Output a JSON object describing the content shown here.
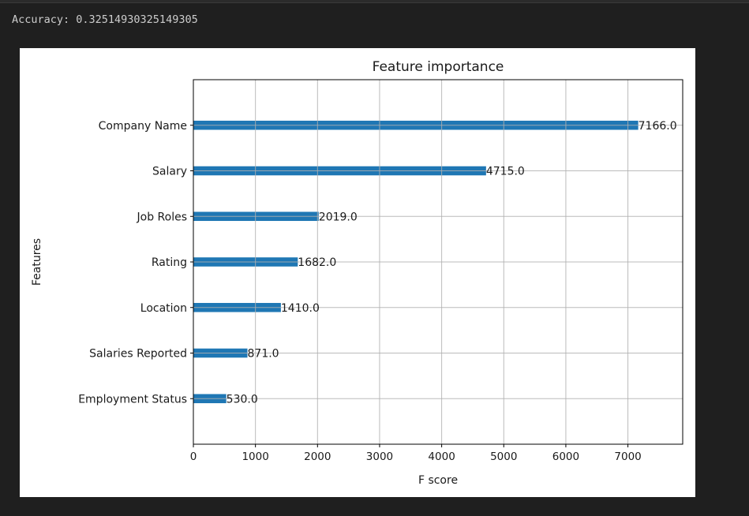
{
  "output": {
    "accuracy_text": "Accuracy: 0.32514930325149305"
  },
  "chart_data": {
    "type": "bar",
    "orientation": "horizontal",
    "title": "Feature importance",
    "xlabel": "F score",
    "ylabel": "Features",
    "categories": [
      "Employment Status",
      "Salaries Reported",
      "Location",
      "Rating",
      "Job Roles",
      "Salary",
      "Company Name"
    ],
    "values": [
      530.0,
      871.0,
      1410.0,
      1682.0,
      2019.0,
      4715.0,
      7166.0
    ],
    "data_labels": [
      "530.0",
      "871.0",
      "1410.0",
      "1682.0",
      "2019.0",
      "4715.0",
      "7166.0"
    ],
    "xlim": [
      0,
      7882.6
    ],
    "ylim": [
      -1,
      7
    ],
    "xticks": [
      0,
      1000,
      2000,
      3000,
      4000,
      5000,
      6000,
      7000
    ],
    "xtick_labels": [
      "0",
      "1000",
      "2000",
      "3000",
      "4000",
      "5000",
      "6000",
      "7000"
    ],
    "grid": true,
    "bar_color": "#1f77b4"
  }
}
